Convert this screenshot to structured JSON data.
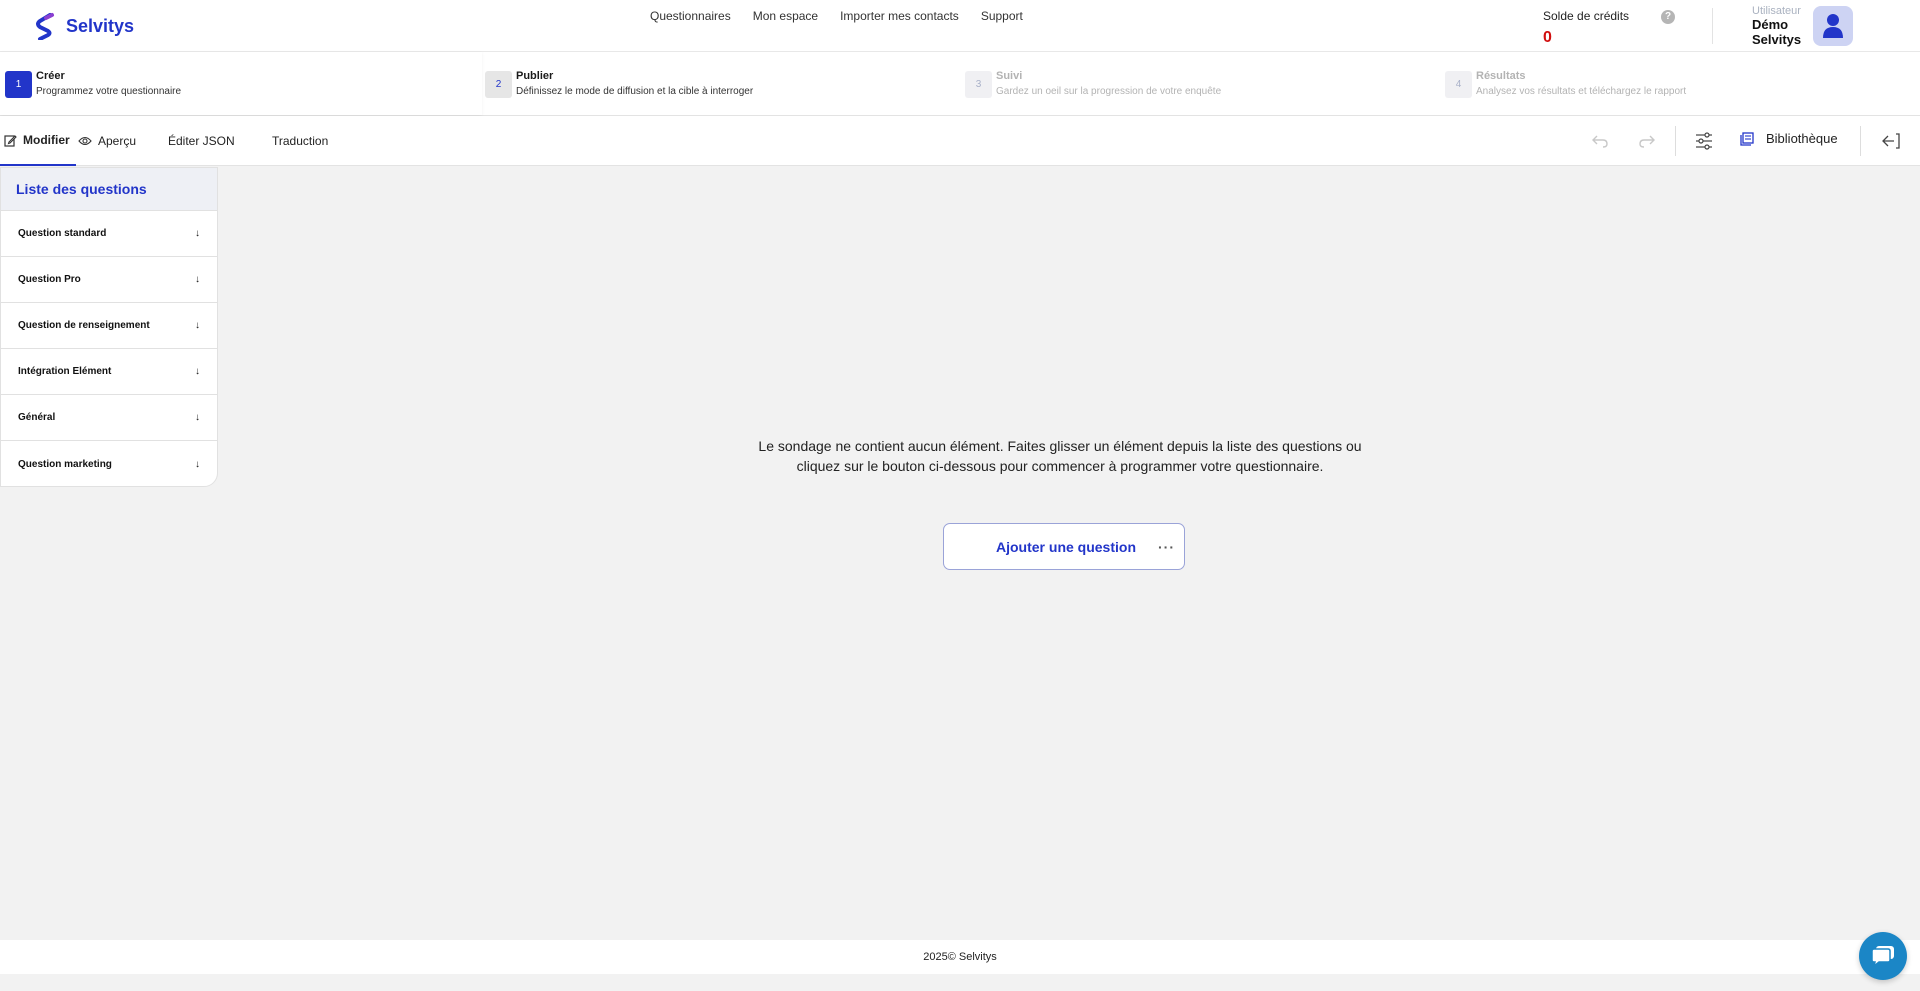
{
  "header": {
    "logo_text": "Selvitys",
    "nav": [
      "Questionnaires",
      "Mon espace",
      "Importer mes contacts",
      "Support"
    ],
    "credits_label": "Solde de crédits",
    "credits_value": "0",
    "user_role": "Utilisateur",
    "user_first": "Démo",
    "user_last": "Selvitys"
  },
  "steps": [
    {
      "num": "1",
      "title": "Créer",
      "desc": "Programmez votre questionnaire"
    },
    {
      "num": "2",
      "title": "Publier",
      "desc": "Définissez le mode de diffusion et la cible à interroger"
    },
    {
      "num": "3",
      "title": "Suivi",
      "desc": "Gardez un oeil sur la progression de votre enquête"
    },
    {
      "num": "4",
      "title": "Résultats",
      "desc": "Analysez vos résultats et téléchargez le rapport"
    }
  ],
  "toolbar": {
    "tabs": [
      "Modifier",
      "Aperçu",
      "Éditer JSON",
      "Traduction"
    ],
    "library": "Bibliothèque"
  },
  "sidebar": {
    "title": "Liste des questions",
    "categories": [
      "Question standard",
      "Question Pro",
      "Question de renseignement",
      "Intégration Elément",
      "Général",
      "Question marketing"
    ]
  },
  "main": {
    "empty_message": "Le sondage ne contient aucun élément. Faites glisser un élément depuis la liste des questions ou cliquez sur le bouton ci-dessous pour commencer à programmer votre questionnaire.",
    "add_question": "Ajouter une question"
  },
  "footer": {
    "text": "2025© Selvitys"
  },
  "colors": {
    "brand": "#2235c9",
    "credits": "#d10f0f",
    "chat": "#1b86c6"
  }
}
